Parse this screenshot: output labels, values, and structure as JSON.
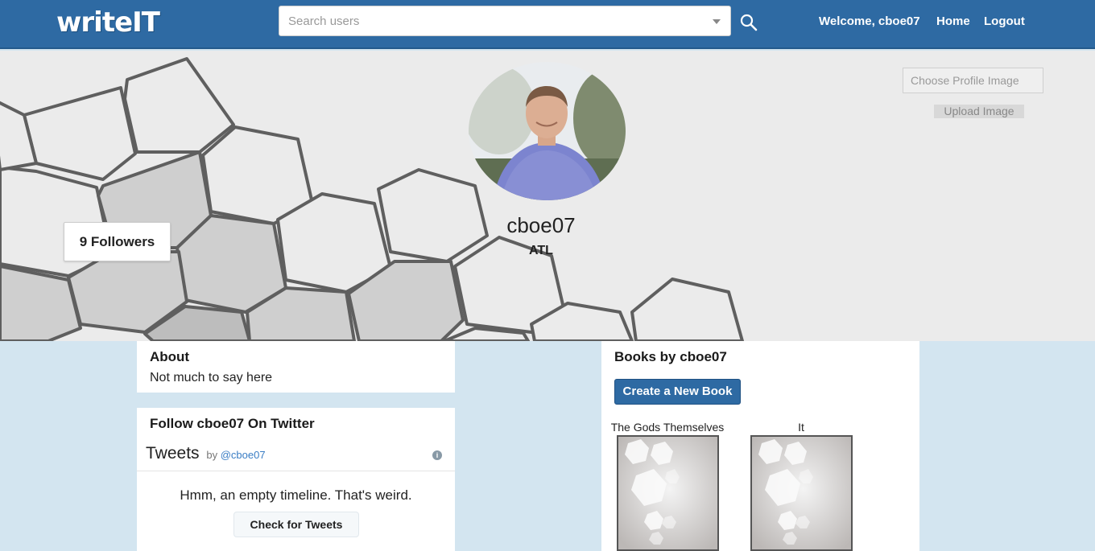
{
  "nav": {
    "brand": "writeIT",
    "search_placeholder": "Search users",
    "welcome": "Welcome, cboe07",
    "home": "Home",
    "logout": "Logout"
  },
  "profile": {
    "followers": "9 Followers",
    "username": "cboe07",
    "location": "ATL",
    "choose_image": "Choose Profile Image",
    "upload_image": "Upload Image"
  },
  "about": {
    "title": "About",
    "text": "Not much to say here"
  },
  "twitter": {
    "title": "Follow cboe07 On Twitter",
    "tweets_label": "Tweets",
    "by": "by",
    "handle": "@cboe07",
    "info_icon": "info-icon",
    "empty_message": "Hmm, an empty timeline. That's weird.",
    "check_button": "Check for Tweets"
  },
  "books": {
    "title": "Books by cboe07",
    "create_button": "Create a New Book",
    "items": [
      {
        "title": "The Gods Themselves"
      },
      {
        "title": "It"
      }
    ]
  },
  "colors": {
    "navbar": "#2e6aa3",
    "page_bg": "#d3e5f0",
    "banner_bg": "#ebebeb"
  }
}
